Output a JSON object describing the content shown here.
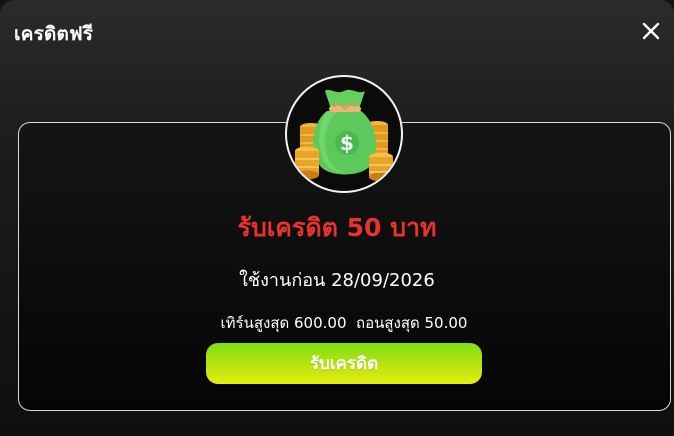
{
  "modal": {
    "title": "เครดิตฟรี",
    "close_icon": "close-icon"
  },
  "credit": {
    "icon": "money-bag-icon",
    "title": "รับเครดิต 50 บาท",
    "use_before": "ใช้งานก่อน 28/09/2026",
    "limits": "เทิร์นสูงสุด 600.00  ถอนสูงสุด 50.00",
    "claim_label": "รับเครดิต"
  },
  "colors": {
    "accent_red": "#e8332d",
    "button_green": "#7fdf16",
    "button_yellow": "#e7ee10",
    "card_border": "#d9d9d9"
  }
}
